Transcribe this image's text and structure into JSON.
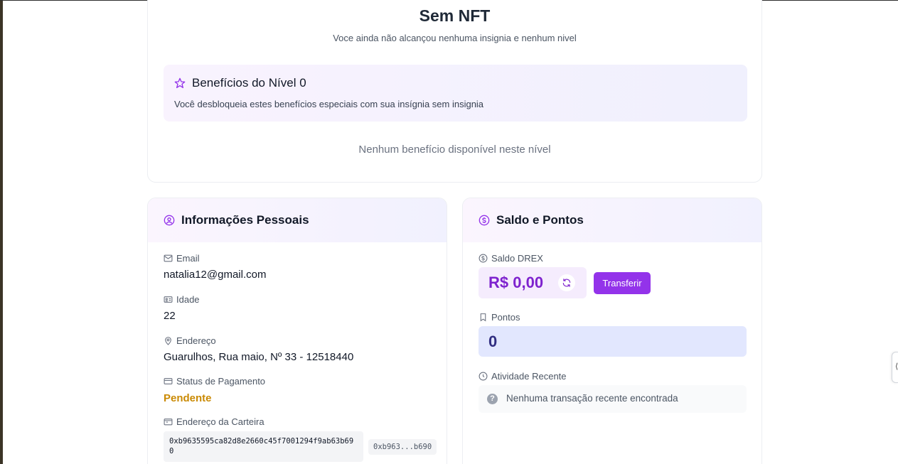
{
  "nft": {
    "title": "Sem NFT",
    "subtitle": "Voce ainda não alcançou nenhuma insignia e nenhum nivel",
    "benefits_title": "Benefícios do Nível 0",
    "benefits_desc": "Você desbloqueia estes benefícios especiais com sua insígnia sem insignia",
    "no_benefits": "Nenhum benefício disponível neste nível"
  },
  "personal": {
    "title": "Informações Pessoais",
    "email_label": "Email",
    "email": "natalia12@gmail.com",
    "age_label": "Idade",
    "age": "22",
    "address_label": "Endereço",
    "address": "Guarulhos, Rua maio, Nº 33 - 12518440",
    "payment_label": "Status de Pagamento",
    "payment_status": "Pendente",
    "wallet_label": "Endereço da Carteira",
    "wallet_full": "0xb9635595ca82d8e2660c45f7001294f9ab63b690",
    "wallet_short": "0xb963...b690"
  },
  "balance": {
    "title": "Saldo e Pontos",
    "drex_label": "Saldo DREX",
    "drex_value": "R$ 0,00",
    "transfer_label": "Transferir",
    "points_label": "Pontos",
    "points_value": "0",
    "activity_label": "Atividade Recente",
    "activity_empty": "Nenhuma transação recente encontrada"
  },
  "side_tab": {
    "glyph": "⟨"
  },
  "colors": {
    "accent": "#9333ea",
    "pending": "#ca8a04",
    "points": "#312e81"
  }
}
